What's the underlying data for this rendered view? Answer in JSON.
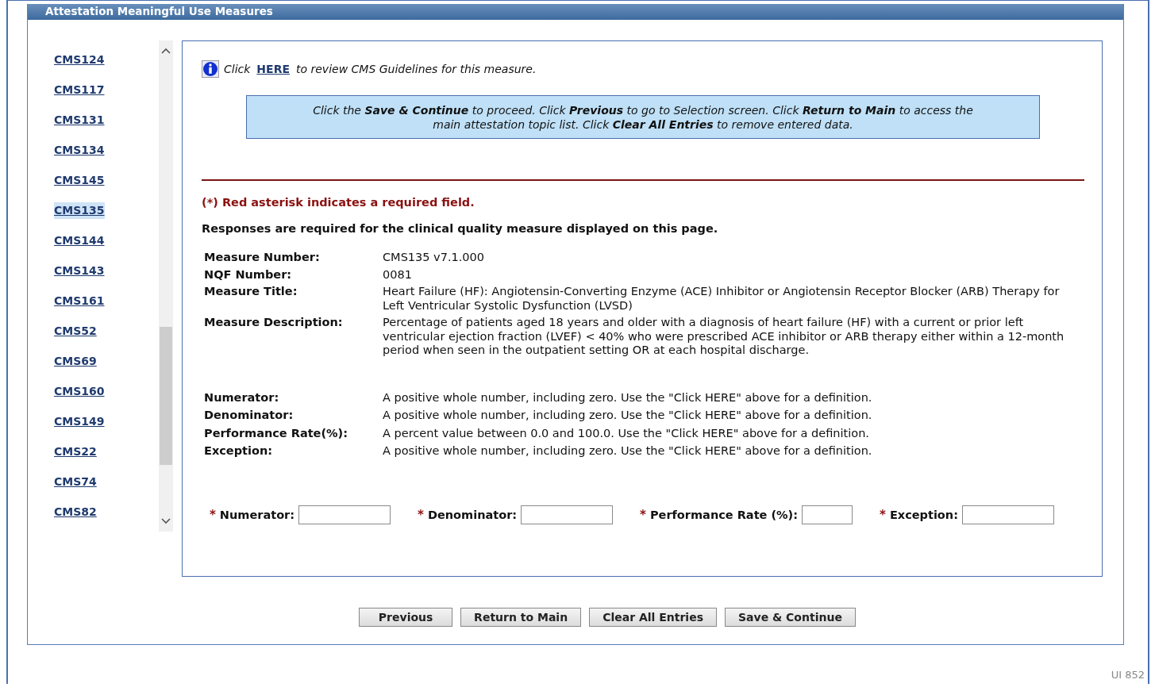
{
  "panel": {
    "title": "Attestation Meaningful Use Measures"
  },
  "sidebar": {
    "items": [
      {
        "label": "CMS124",
        "selected": false
      },
      {
        "label": "CMS117",
        "selected": false
      },
      {
        "label": "CMS131",
        "selected": false
      },
      {
        "label": "CMS134",
        "selected": false
      },
      {
        "label": "CMS145",
        "selected": false
      },
      {
        "label": "CMS135",
        "selected": true
      },
      {
        "label": "CMS144",
        "selected": false
      },
      {
        "label": "CMS143",
        "selected": false
      },
      {
        "label": "CMS161",
        "selected": false
      },
      {
        "label": "CMS52",
        "selected": false
      },
      {
        "label": "CMS69",
        "selected": false
      },
      {
        "label": "CMS160",
        "selected": false
      },
      {
        "label": "CMS149",
        "selected": false
      },
      {
        "label": "CMS22",
        "selected": false
      },
      {
        "label": "CMS74",
        "selected": false
      },
      {
        "label": "CMS82",
        "selected": false
      }
    ]
  },
  "guideline": {
    "before": "Click",
    "link": "HERE",
    "after": "to review CMS Guidelines for this measure."
  },
  "instructions": "Click the **Save & Continue** to proceed. Click **Previous** to go to Selection screen. Click **Return to Main** to access the\nmain attestation topic list. Click **Clear All Entries** to remove entered data.",
  "required_note": "(*) Red asterisk indicates a required field.",
  "responses_note": "Responses are required for the clinical quality measure displayed on this page.",
  "details": [
    {
      "label": "Measure Number:",
      "value": "CMS135 v7.1.000"
    },
    {
      "label": "NQF Number:",
      "value": "0081"
    },
    {
      "label": "Measure Title:",
      "value": "Heart Failure (HF): Angiotensin-Converting Enzyme (ACE) Inhibitor or Angiotensin Receptor Blocker (ARB) Therapy for Left Ventricular Systolic Dysfunction (LVSD)"
    },
    {
      "label": "Measure Description:",
      "value": "Percentage of patients aged 18 years and older with a diagnosis of heart failure (HF) with a current or prior left ventricular ejection fraction (LVEF) < 40% who were prescribed ACE inhibitor or ARB therapy either within a 12-month period when seen in the outpatient setting OR at each hospital discharge."
    }
  ],
  "definitions": [
    {
      "label": "Numerator:",
      "value": "A positive whole number, including zero. Use the \"Click HERE\" above for a definition."
    },
    {
      "label": "Denominator:",
      "value": "A positive whole number, including zero. Use the \"Click HERE\" above for a definition."
    },
    {
      "label": "Performance Rate(%):",
      "value": "A percent value between 0.0 and 100.0. Use the \"Click HERE\" above for a definition."
    },
    {
      "label": "Exception:",
      "value": "A positive whole number, including zero. Use the \"Click HERE\" above for a definition."
    }
  ],
  "fields": [
    {
      "asterisk": "*",
      "label": "Numerator:"
    },
    {
      "asterisk": "*",
      "label": "Denominator:"
    },
    {
      "asterisk": "*",
      "label": "Performance Rate (%):"
    },
    {
      "asterisk": "*",
      "label": "Exception:"
    }
  ],
  "buttons": [
    "Previous",
    "Return to Main",
    "Clear All Entries",
    "Save & Continue"
  ],
  "footer": "UI 852"
}
